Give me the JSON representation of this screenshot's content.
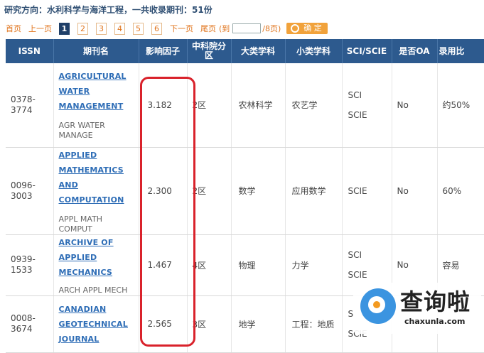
{
  "header": {
    "title": "研究方向：水利科学与海洋工程，一共收录期刊：51份"
  },
  "pagination": {
    "first": "首页",
    "prev": "上一页",
    "pages": [
      "1",
      "2",
      "3",
      "4",
      "5",
      "6"
    ],
    "current": "1",
    "next": "下一页",
    "last": "尾页",
    "goto_prefix": "(到",
    "goto_value": "",
    "goto_suffix": "/8页)",
    "confirm": "确 定"
  },
  "table": {
    "columns": [
      "ISSN",
      "期刊名",
      "影响因子",
      "中科院分区",
      "大类学科",
      "小类学科",
      "SCI/SCIE",
      "是否OA",
      "录用比"
    ],
    "rows": [
      {
        "issn": "0378-3774",
        "name_lines": [
          "AGRICULTURAL",
          "WATER",
          "MANAGEMENT"
        ],
        "abbr": "AGR WATER MANAGE",
        "impact": "3.182",
        "zone": "2区",
        "major": "农林科学",
        "minor": "农艺学",
        "sci": [
          "SCI",
          "SCIE"
        ],
        "oa": "No",
        "rate": "约50%"
      },
      {
        "issn": "0096-3003",
        "name_lines": [
          "APPLIED",
          "MATHEMATICS AND",
          "COMPUTATION"
        ],
        "abbr": "APPL MATH COMPUT",
        "impact": "2.300",
        "zone": "2区",
        "major": "数学",
        "minor": "应用数学",
        "sci": [
          "SCIE"
        ],
        "oa": "No",
        "rate": "60%"
      },
      {
        "issn": "0939-1533",
        "name_lines": [
          "ARCHIVE OF",
          "APPLIED MECHANICS"
        ],
        "abbr": "ARCH APPL MECH",
        "impact": "1.467",
        "zone": "4区",
        "major": "物理",
        "minor": "力学",
        "sci": [
          "SCI",
          "SCIE"
        ],
        "oa": "No",
        "rate": "容易"
      },
      {
        "issn": "0008-3674",
        "name_lines": [
          "CANADIAN",
          "GEOTECHNICAL",
          "JOURNAL"
        ],
        "abbr": "",
        "impact": "2.565",
        "zone": "3区",
        "major": "地学",
        "minor": "工程：地质",
        "sci": [
          "S",
          "SCIE"
        ],
        "oa": "",
        "rate": ""
      }
    ]
  },
  "watermark": {
    "brand": "查询啦",
    "url": "chaxunla.com"
  },
  "colors": {
    "header_bg": "#2d5a8e",
    "link": "#2e6db6",
    "highlight": "#d9222b",
    "pager": "#e0741c"
  }
}
